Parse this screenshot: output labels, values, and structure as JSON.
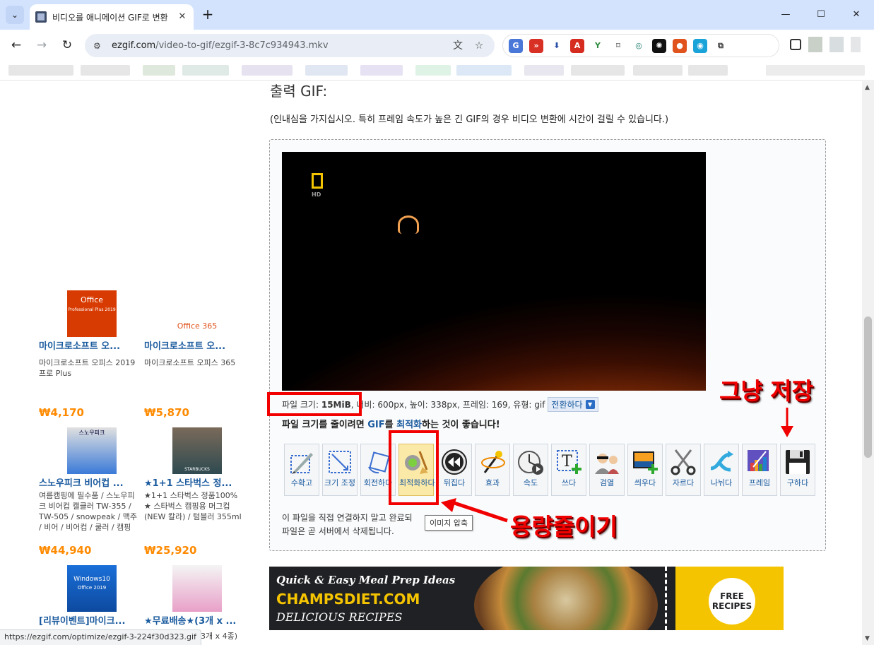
{
  "browser": {
    "tab_title": "비디오를 애니메이션 GIF로 변환",
    "url_host": "ezgif.com",
    "url_path": "/video-to-gif/ezgif-3-8c7c934943.mkv",
    "status_url": "https://ezgif.com/optimize/ezgif-3-224f30d323.gif"
  },
  "page": {
    "title_partial": "출력 GIF:",
    "notice": "(인내심을 가지십시오. 특히 프레임 속도가 높은 긴 GIF의 경우 비디오 변환에 시간이 걸릴 수 있습니다.)",
    "file_info": {
      "size_label": "파일 크기:",
      "size_value": "15MiB",
      "rest": ", 너비: 600px, 높이: 338px, 프레임: 169, 유형: gif",
      "convert_label": "전환하다"
    },
    "hint": {
      "prefix": "파일 크기를 줄이려면 ",
      "gif": "GIF",
      "mid": "를 ",
      "optimize": "최적화",
      "suffix": "하는 것이 좋습니다!"
    },
    "tools": [
      {
        "label": "수확고",
        "icon": "crop-icon"
      },
      {
        "label": "크기 조정",
        "icon": "resize-icon"
      },
      {
        "label": "회전하다",
        "icon": "rotate-icon"
      },
      {
        "label": "최적화하다",
        "icon": "optimize-icon"
      },
      {
        "label": "뒤집다",
        "icon": "reverse-icon"
      },
      {
        "label": "효과",
        "icon": "effects-icon"
      },
      {
        "label": "속도",
        "icon": "speed-icon"
      },
      {
        "label": "쓰다",
        "icon": "write-text-icon"
      },
      {
        "label": "검열",
        "icon": "censor-icon"
      },
      {
        "label": "씌우다",
        "icon": "overlay-icon"
      },
      {
        "label": "자르다",
        "icon": "cut-icon"
      },
      {
        "label": "나뉘다",
        "icon": "split-icon"
      },
      {
        "label": "프레임",
        "icon": "frames-icon"
      },
      {
        "label": "구하다",
        "icon": "save-icon"
      }
    ],
    "footer_line1": "이 파일을 직접 연결하지 말고 완료되",
    "footer_line2": "파일은 곧 서버에서 삭제됩니다.",
    "tooltip": "이미지 압축"
  },
  "annotations": {
    "save_note": "그냥 저장",
    "optimize_note": "용량줄이기"
  },
  "sidebar": {
    "products": [
      {
        "name": "마이크로소프트 오...",
        "desc": "마이크로소프트 오피스 2019 프로 Plus",
        "price": "₩4,170",
        "img_text": "Office",
        "img_sub": "Professional Plus 2019"
      },
      {
        "name": "마이크로소프트 오...",
        "desc": "마이크로소프트 오피스 365",
        "price": "₩5,870",
        "img_text": "Office 365"
      },
      {
        "name": "스노우피크 비어컵 ...",
        "desc": "여름캠핑에 필수품 / 스노우피크 비어컵 캘클러 TW-355 / TW-505 / snowpeak / 맥주 / 비어 / 비어컵 / 쿨러 / 캠핑",
        "price": "₩44,940",
        "img_text": "스노우피크"
      },
      {
        "name": "★1+1 스타벅스 정...",
        "desc": "★1+1 스타벅스 정품100% ★ 스타벅스 캠핑용 머그컵(NEW 칼라) / 텀블러 355ml",
        "price": "₩25,920",
        "img_text": "STARBUCKS"
      },
      {
        "name": "[리뷰이벤트]마이크...",
        "img_text": "Windows10",
        "img_sub": "Office 2019"
      },
      {
        "name": "★무료배송★(3개 x ...",
        "desc": "3개 x 4종)"
      }
    ]
  },
  "ad": {
    "line1": "Quick & Easy Meal Prep Ideas",
    "line2": "CHAMPSDIET.COM",
    "line3": "DELICIOUS RECIPES",
    "badge_line1": "FREE",
    "badge_line2": "RECIPES"
  }
}
